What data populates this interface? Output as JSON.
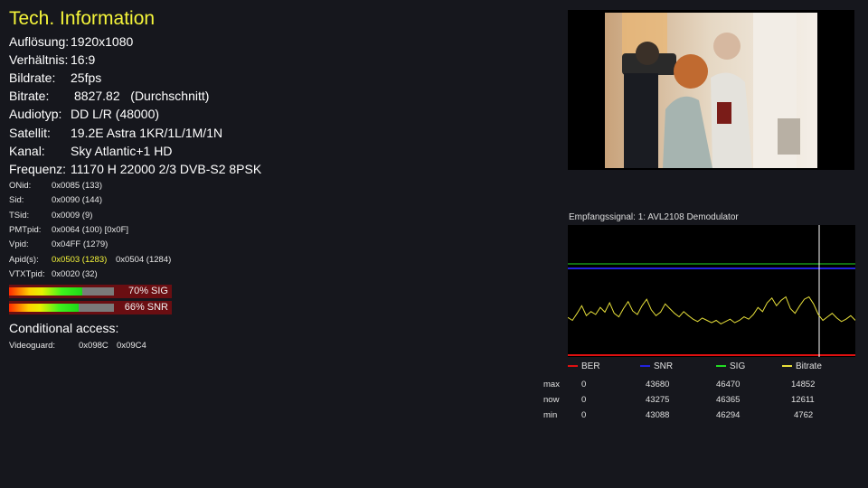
{
  "title": "Tech. Information",
  "info": [
    {
      "label": "Auflösung:",
      "value": "1920x1080"
    },
    {
      "label": "Verhältnis:",
      "value": "16:9"
    },
    {
      "label": "Bildrate:",
      "value": "25fps"
    },
    {
      "label": "Bitrate:",
      "value": "8827.82   (Durchschnitt)"
    },
    {
      "label": "Audiotyp:",
      "value": "DD L/R (48000)"
    },
    {
      "label": "Satellit:",
      "value": "19.2E Astra 1KR/1L/1M/1N"
    },
    {
      "label": "Kanal:",
      "value": "Sky Atlantic+1 HD"
    },
    {
      "label": "Frequenz:",
      "value": "11170 H 22000 2/3 DVB-S2 8PSK"
    }
  ],
  "pids": [
    {
      "label": "ONid:",
      "value": "0x0085 (133)"
    },
    {
      "label": "Sid:",
      "value": "0x0090 (144)"
    },
    {
      "label": "TSid:",
      "value": "0x0009 (9)"
    },
    {
      "label": "PMTpid:",
      "value": "0x0064 (100) [0x0F]"
    },
    {
      "label": "Vpid:",
      "value": "0x04FF (1279)"
    },
    {
      "label": "Apid(s):",
      "value": "0x0503 (1283)",
      "value2": "0x0504 (1284)"
    },
    {
      "label": "VTXTpid:",
      "value": "0x0020 (32)"
    }
  ],
  "meters": {
    "sig": {
      "label": "70% SIG",
      "percent": 70
    },
    "snr": {
      "label": "66% SNR",
      "percent": 66
    }
  },
  "conditional_access": {
    "title": "Conditional access:",
    "system": "Videoguard:",
    "ids": [
      "0x098C",
      "0x09C4"
    ]
  },
  "graph": {
    "title": "Empfangssignal: 1: AVL2108 Demodulator",
    "colors": {
      "BER": "#e01010",
      "SNR": "#2222dd",
      "SIG": "#22dd22",
      "Bitrate": "#e8e03a"
    },
    "legend": [
      "BER",
      "SNR",
      "SIG",
      "Bitrate"
    ],
    "stats": {
      "columns": [
        "BER",
        "SNR",
        "SIG",
        "Bitrate"
      ],
      "rows": [
        {
          "label": "max",
          "values": [
            "0",
            "43680",
            "46470",
            "14852"
          ]
        },
        {
          "label": "now",
          "values": [
            "0",
            "43275",
            "46365",
            "12611"
          ]
        },
        {
          "label": "min",
          "values": [
            "0",
            "43088",
            "46294",
            "4762"
          ]
        }
      ]
    },
    "bitrate_trace": [
      0.35,
      0.3,
      0.42,
      0.55,
      0.38,
      0.45,
      0.4,
      0.52,
      0.44,
      0.6,
      0.42,
      0.36,
      0.5,
      0.62,
      0.46,
      0.4,
      0.55,
      0.66,
      0.48,
      0.38,
      0.44,
      0.58,
      0.5,
      0.42,
      0.36,
      0.45,
      0.38,
      0.32,
      0.28,
      0.34,
      0.3,
      0.26,
      0.3,
      0.24,
      0.28,
      0.32,
      0.26,
      0.3,
      0.36,
      0.32,
      0.4,
      0.52,
      0.45,
      0.6,
      0.68,
      0.55,
      0.64,
      0.7,
      0.5,
      0.42,
      0.55,
      0.66,
      0.7,
      0.58,
      0.4,
      0.3,
      0.36,
      0.42,
      0.34,
      0.28,
      0.32,
      0.38,
      0.3
    ]
  }
}
